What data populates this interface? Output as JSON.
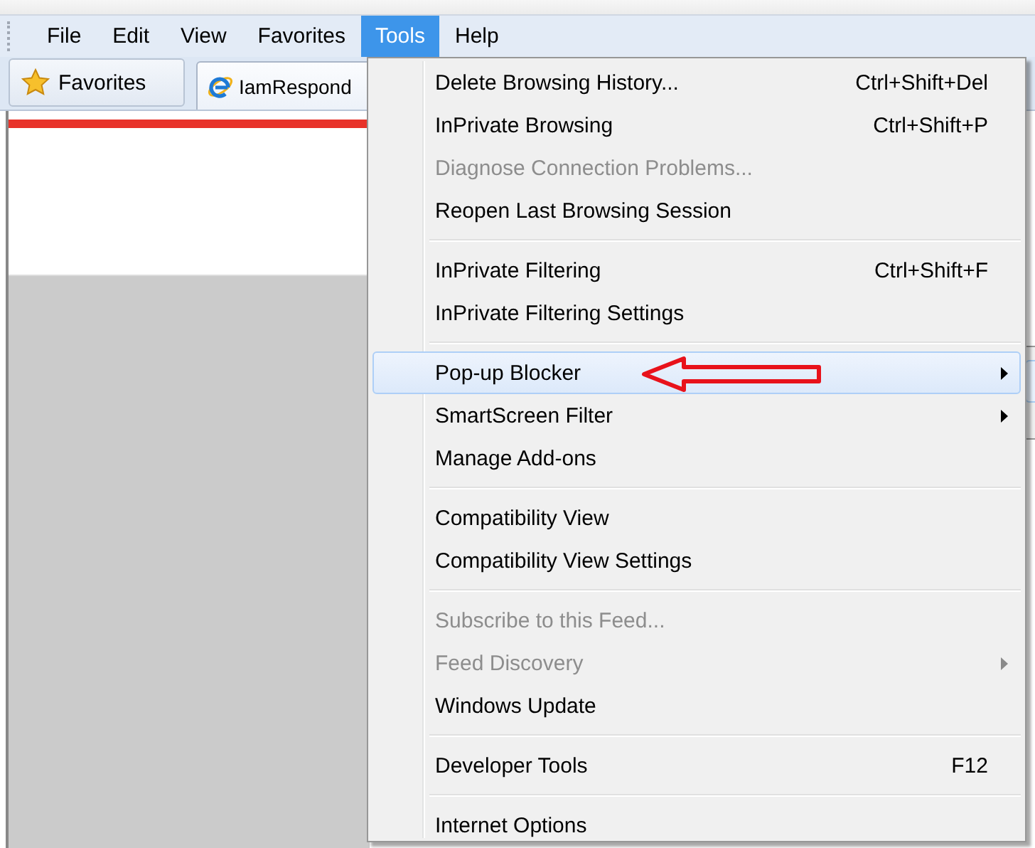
{
  "menubar": [
    {
      "label": "File",
      "selected": false
    },
    {
      "label": "Edit",
      "selected": false
    },
    {
      "label": "View",
      "selected": false
    },
    {
      "label": "Favorites",
      "selected": false
    },
    {
      "label": "Tools",
      "selected": true
    },
    {
      "label": "Help",
      "selected": false
    }
  ],
  "favorites_button": {
    "label": "Favorites"
  },
  "tab": {
    "title": "IamRespond"
  },
  "tools_menu": {
    "groups": [
      [
        {
          "label": "Delete Browsing History...",
          "shortcut": "Ctrl+Shift+Del",
          "disabled": false,
          "submenu": false,
          "selected": false,
          "annotated": false
        },
        {
          "label": "InPrivate Browsing",
          "shortcut": "Ctrl+Shift+P",
          "disabled": false,
          "submenu": false,
          "selected": false,
          "annotated": false
        },
        {
          "label": "Diagnose Connection Problems...",
          "disabled": true,
          "submenu": false,
          "selected": false,
          "annotated": false
        },
        {
          "label": "Reopen Last Browsing Session",
          "disabled": false,
          "submenu": false,
          "selected": false,
          "annotated": false
        }
      ],
      [
        {
          "label": "InPrivate Filtering",
          "shortcut": "Ctrl+Shift+F",
          "disabled": false,
          "submenu": false,
          "selected": false,
          "annotated": false
        },
        {
          "label": "InPrivate Filtering Settings",
          "disabled": false,
          "submenu": false,
          "selected": false,
          "annotated": false
        }
      ],
      [
        {
          "label": "Pop-up Blocker",
          "disabled": false,
          "submenu": true,
          "selected": true,
          "annotated": true
        },
        {
          "label": "SmartScreen Filter",
          "disabled": false,
          "submenu": true,
          "selected": false,
          "annotated": false
        },
        {
          "label": "Manage Add-ons",
          "disabled": false,
          "submenu": false,
          "selected": false,
          "annotated": false
        }
      ],
      [
        {
          "label": "Compatibility View",
          "disabled": false,
          "submenu": false,
          "selected": false,
          "annotated": false
        },
        {
          "label": "Compatibility View Settings",
          "disabled": false,
          "submenu": false,
          "selected": false,
          "annotated": false
        }
      ],
      [
        {
          "label": "Subscribe to this Feed...",
          "disabled": true,
          "submenu": false,
          "selected": false,
          "annotated": false
        },
        {
          "label": "Feed Discovery",
          "disabled": true,
          "submenu": true,
          "selected": false,
          "annotated": false
        },
        {
          "label": "Windows Update",
          "disabled": false,
          "submenu": false,
          "selected": false,
          "annotated": false
        }
      ],
      [
        {
          "label": "Developer Tools",
          "shortcut": "F12",
          "disabled": false,
          "submenu": false,
          "selected": false,
          "annotated": false
        }
      ],
      [
        {
          "label": "Internet Options",
          "disabled": false,
          "submenu": false,
          "selected": false,
          "annotated": false
        }
      ]
    ]
  }
}
